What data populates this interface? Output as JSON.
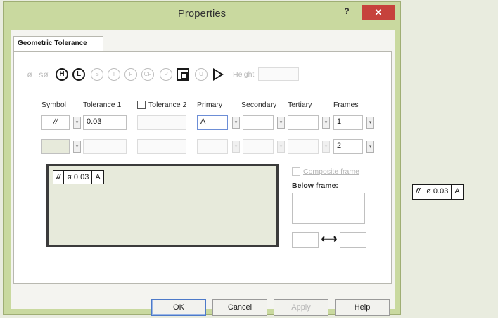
{
  "window": {
    "title": "Properties",
    "help_glyph": "?",
    "close_glyph": "✕"
  },
  "tabs": [
    {
      "label": "Geometric Tolerance"
    }
  ],
  "modifiers": {
    "items": [
      {
        "name": "diameter",
        "glyph": "ø"
      },
      {
        "name": "spherical-diameter",
        "glyph": "sø"
      },
      {
        "name": "H",
        "glyph": "H"
      },
      {
        "name": "L",
        "glyph": "L"
      },
      {
        "name": "S",
        "glyph": "S"
      },
      {
        "name": "T",
        "glyph": "T"
      },
      {
        "name": "F",
        "glyph": "F"
      },
      {
        "name": "CF",
        "glyph": "CF"
      },
      {
        "name": "P",
        "glyph": "P"
      }
    ],
    "u_glyph": "U",
    "height_label": "Height"
  },
  "headers": {
    "symbol": "Symbol",
    "tolerance1": "Tolerance 1",
    "tolerance2": "Tolerance 2",
    "primary": "Primary",
    "secondary": "Secondary",
    "tertiary": "Tertiary",
    "frames": "Frames"
  },
  "row1": {
    "symbol_glyph": "//",
    "tolerance1": "0.03",
    "primary": "A",
    "frames": "1"
  },
  "row2": {
    "frames": "2"
  },
  "preview": {
    "symbol": "//",
    "diameter": "ø",
    "value": "0.03",
    "datum": "A"
  },
  "composite_frame_label": "Composite frame",
  "below_frame_label": "Below frame:",
  "arrow_glyph": "⟷",
  "dropdown_glyph": "▾",
  "buttons": {
    "ok": "OK",
    "cancel": "Cancel",
    "apply": "Apply",
    "help": "Help"
  },
  "external_preview": {
    "symbol": "//",
    "diameter": "ø",
    "value": "0.03",
    "datum": "A"
  }
}
